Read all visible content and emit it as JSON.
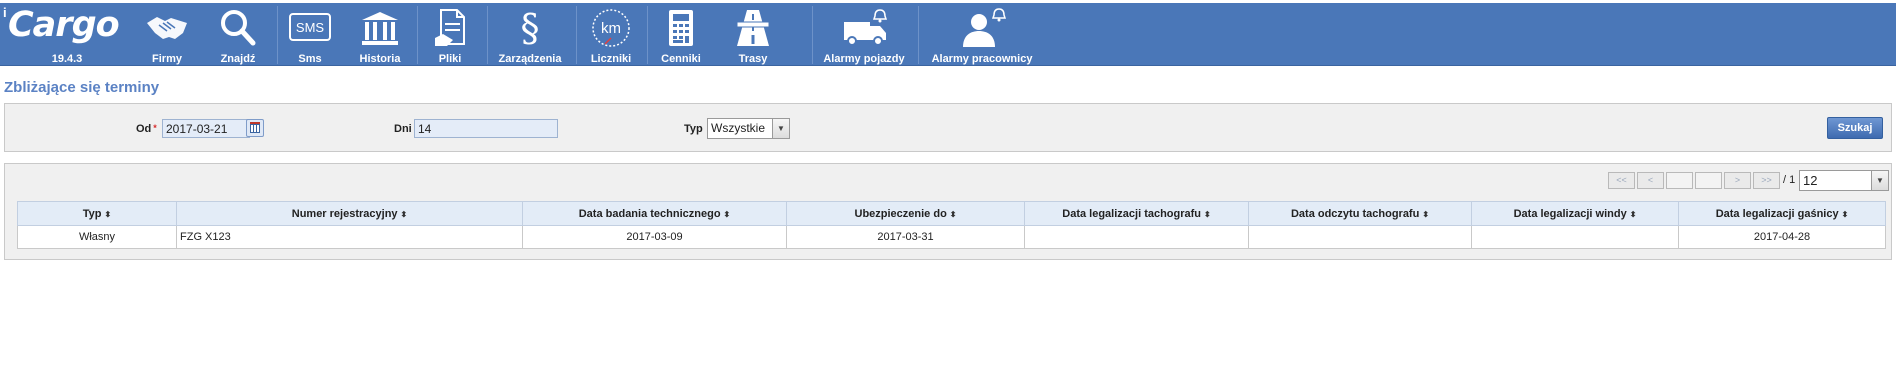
{
  "app": {
    "brand": "Cargo",
    "brand_prefix": "i",
    "version": "19.4.3"
  },
  "nav": [
    {
      "label": "Firmy",
      "icon": "handshake-icon"
    },
    {
      "label": "Znajdź",
      "icon": "search-icon"
    },
    {
      "label": "Sms",
      "icon": "sms-icon",
      "icon_text": "SMS"
    },
    {
      "label": "Historia",
      "icon": "history-columns-icon"
    },
    {
      "label": "Pliki",
      "icon": "files-icon"
    },
    {
      "label": "Zarządzenia",
      "icon": "paragraph-icon",
      "icon_text": "§"
    },
    {
      "label": "Liczniki",
      "icon": "odometer-icon",
      "icon_text": "km"
    },
    {
      "label": "Cenniki",
      "icon": "calculator-icon"
    },
    {
      "label": "Trasy",
      "icon": "road-icon"
    },
    {
      "label": "Alarmy pojazdy",
      "icon": "truck-alarm-icon"
    },
    {
      "label": "Alarmy pracownicy",
      "icon": "person-alarm-icon"
    }
  ],
  "page": {
    "title": "Zbliżające się terminy"
  },
  "filters": {
    "od_label": "Od",
    "od_required": "*",
    "od_value": "2017-03-21",
    "dni_label": "Dni",
    "dni_value": "14",
    "typ_label": "Typ",
    "typ_value": "Wszystkie",
    "search_label": "Szukaj"
  },
  "pager": {
    "first": "<<",
    "prev": "<",
    "next": ">",
    "last": ">>",
    "total": "/ 1",
    "page_size": "12"
  },
  "table": {
    "columns": [
      "Typ",
      "Numer rejestracyjny",
      "Data badania technicznego",
      "Ubezpieczenie do",
      "Data legalizacji tachografu",
      "Data odczytu tachografu",
      "Data legalizacji windy",
      "Data legalizacji gaśnicy"
    ],
    "rows": [
      [
        "Własny",
        "FZG X123",
        "2017-03-09",
        "2017-03-31",
        "",
        "",
        "",
        "2017-04-28"
      ]
    ]
  }
}
